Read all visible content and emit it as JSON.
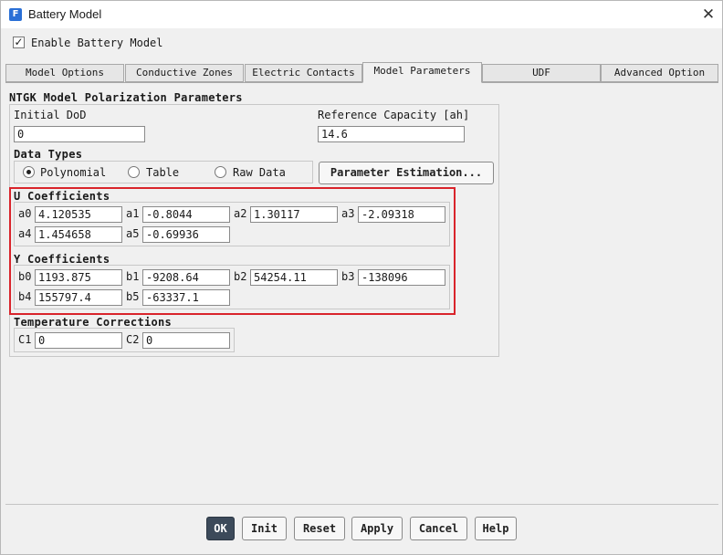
{
  "window": {
    "title": "Battery Model",
    "app_icon_letter": "F"
  },
  "enable_battery_model": {
    "label": "Enable Battery Model",
    "checked": true
  },
  "tabs": [
    {
      "label": "Model Options",
      "active": false
    },
    {
      "label": "Conductive Zones",
      "active": false
    },
    {
      "label": "Electric Contacts",
      "active": false
    },
    {
      "label": "Model Parameters",
      "active": true
    },
    {
      "label": "UDF",
      "active": false
    },
    {
      "label": "Advanced Option",
      "active": false
    }
  ],
  "ntgk": {
    "title": "NTGK Model Polarization Parameters",
    "initial_dod": {
      "label": "Initial DoD",
      "value": "0"
    },
    "reference_capacity": {
      "label": "Reference Capacity [ah]",
      "value": "14.6"
    },
    "data_types": {
      "title": "Data Types",
      "options": [
        {
          "label": "Polynomial",
          "selected": true
        },
        {
          "label": "Table",
          "selected": false
        },
        {
          "label": "Raw Data",
          "selected": false
        }
      ]
    },
    "parameter_estimation_button": "Parameter Estimation...",
    "u_coefficients": {
      "title": "U Coefficients",
      "items": [
        {
          "label": "a0",
          "value": "4.120535"
        },
        {
          "label": "a1",
          "value": "-0.8044"
        },
        {
          "label": "a2",
          "value": "1.30117"
        },
        {
          "label": "a3",
          "value": "-2.09318"
        },
        {
          "label": "a4",
          "value": "1.454658"
        },
        {
          "label": "a5",
          "value": "-0.69936"
        }
      ]
    },
    "y_coefficients": {
      "title": "Y Coefficients",
      "items": [
        {
          "label": "b0",
          "value": "1193.875"
        },
        {
          "label": "b1",
          "value": "-9208.64"
        },
        {
          "label": "b2",
          "value": "54254.11"
        },
        {
          "label": "b3",
          "value": "-138096"
        },
        {
          "label": "b4",
          "value": "155797.4"
        },
        {
          "label": "b5",
          "value": "-63337.1"
        }
      ]
    },
    "temperature_corrections": {
      "title": "Temperature Corrections",
      "items": [
        {
          "label": "C1",
          "value": "0"
        },
        {
          "label": "C2",
          "value": "0"
        }
      ]
    }
  },
  "buttons": {
    "ok": "OK",
    "init": "Init",
    "reset": "Reset",
    "apply": "Apply",
    "cancel": "Cancel",
    "help": "Help"
  },
  "colors": {
    "highlight": "#d9242b",
    "primary_button": "#3c4a5a",
    "app_icon": "#2a6fd6"
  },
  "icons": {
    "close": "close-icon",
    "check": "checkmark-icon"
  }
}
